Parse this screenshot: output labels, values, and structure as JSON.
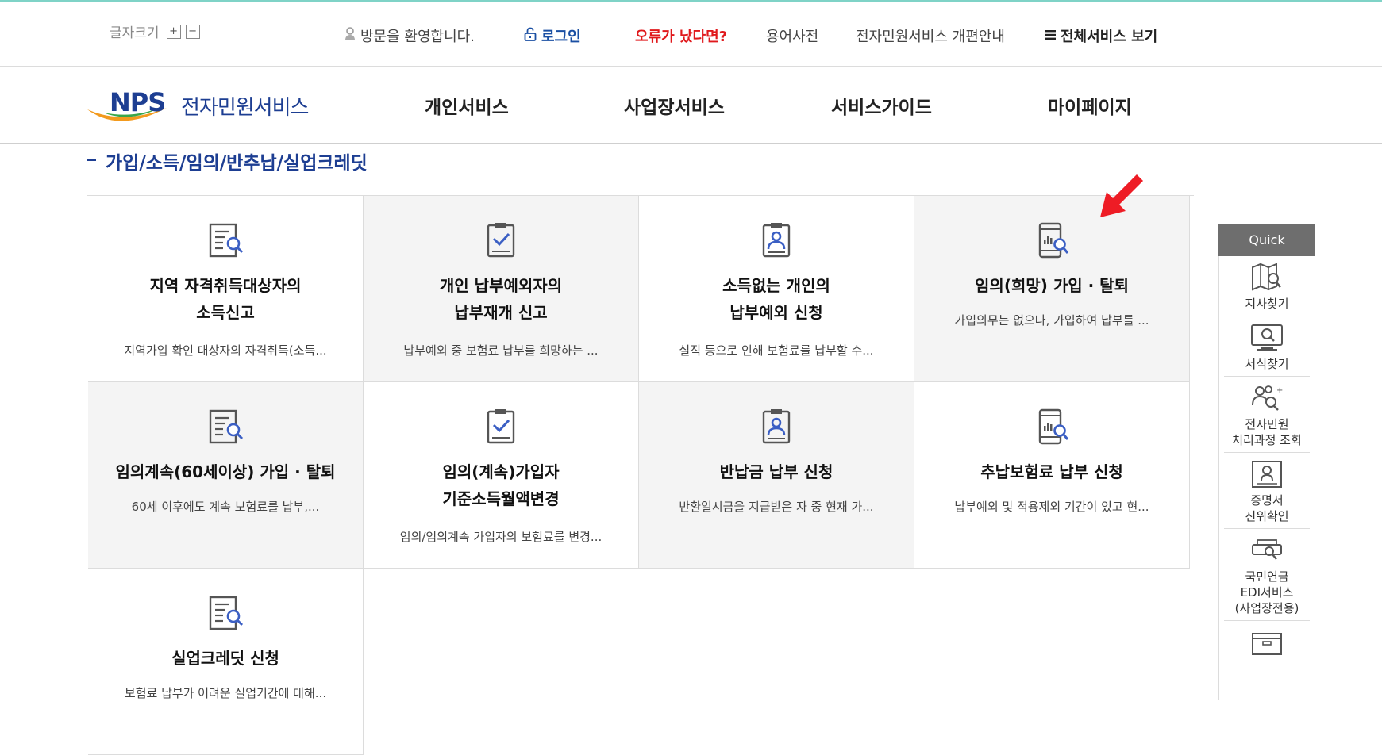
{
  "utility": {
    "font_size_label": "글자크기",
    "font_plus": "+",
    "font_minus": "−",
    "welcome": "방문을 환영합니다.",
    "login": "로그인",
    "error": "오류가 났다면?",
    "dictionary": "용어사전",
    "renewal_guide": "전자민원서비스 개편안내",
    "all_services": "전체서비스 보기"
  },
  "header": {
    "logo_mark": "NPS",
    "logo_service": "전자민원서비스",
    "nav": [
      "개인서비스",
      "사업장서비스",
      "서비스가이드",
      "마이페이지"
    ]
  },
  "section": {
    "title": "가입/소득/임의/반추납/실업크레딧"
  },
  "cards": [
    {
      "title": "지역 자격취득대상자의\n소득신고",
      "desc": "지역가입 확인 대상자의 자격취득(소득...",
      "icon": "document-search-icon"
    },
    {
      "title": "개인 납부예외자의\n납부재개 신고",
      "desc": "납부예외 중 보험료 납부를 희망하는 ...",
      "icon": "clipboard-check-icon"
    },
    {
      "title": "소득없는 개인의\n납부예외 신청",
      "desc": "실직 등으로 인해 보험료를 납부할 수...",
      "icon": "id-card-person-icon"
    },
    {
      "title": "임의(희망) 가입 · 탈퇴",
      "desc": "가입의무는 없으나, 가입하여 납부를 ...",
      "icon": "mobile-chart-search-icon"
    },
    {
      "title": "임의계속(60세이상) 가입 · 탈퇴",
      "desc": "60세 이후에도 계속 보험료를 납부,...",
      "icon": "document-search-icon"
    },
    {
      "title": "임의(계속)가입자\n기준소득월액변경",
      "desc": "임의/임의계속 가입자의 보험료를 변경...",
      "icon": "clipboard-check-icon"
    },
    {
      "title": "반납금 납부 신청",
      "desc": "반환일시금을 지급받은 자 중 현재 가...",
      "icon": "id-card-person-icon"
    },
    {
      "title": "추납보험료 납부 신청",
      "desc": "납부예외 및 적용제외 기간이 있고 현...",
      "icon": "mobile-chart-search-icon"
    },
    {
      "title": "실업크레딧 신청",
      "desc": "보험료 납부가 어려운 실업기간에 대해...",
      "icon": "document-search-icon"
    }
  ],
  "quick": {
    "title": "Quick",
    "items": [
      {
        "label": "지사찾기",
        "icon": "map-search-icon"
      },
      {
        "label": "서식찾기",
        "icon": "monitor-search-icon"
      },
      {
        "label": "전자민원\n처리과정 조회",
        "icon": "people-search-icon"
      },
      {
        "label": "증명서\n진위확인",
        "icon": "certificate-icon"
      },
      {
        "label": "국민연금\nEDI서비스\n(사업장전용)",
        "icon": "edi-device-icon"
      },
      {
        "label": "",
        "icon": "box-icon"
      }
    ]
  },
  "colors": {
    "brand_blue": "#1d3e92",
    "login_blue": "#1a4fa3",
    "error_red": "#e0191c",
    "arrow_red": "#ee1c25",
    "quick_header": "#6e6e6e",
    "card_gray": "#f4f4f4",
    "icon_gray": "#555555",
    "icon_blue": "#3b5fc4"
  }
}
